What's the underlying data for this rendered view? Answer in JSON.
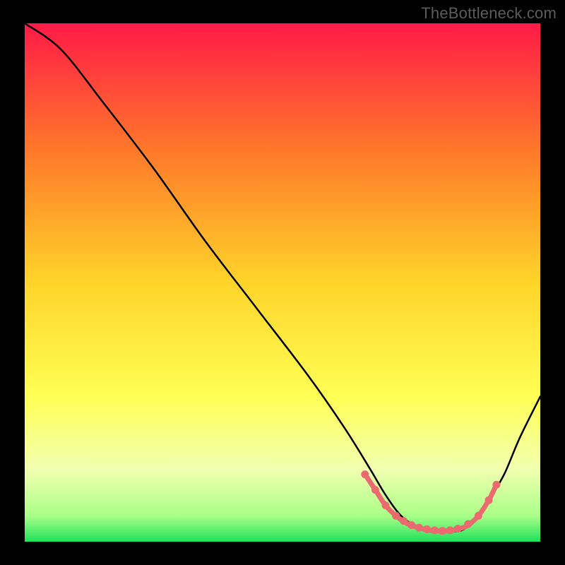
{
  "watermark": "TheBottleneck.com",
  "chart_data": {
    "type": "line",
    "title": "",
    "xlabel": "",
    "ylabel": "",
    "xlim": [
      0,
      100
    ],
    "ylim": [
      0,
      100
    ],
    "grid": false,
    "legend": false,
    "gradient_stops": [
      {
        "offset": 0.0,
        "color": "#ff1a47"
      },
      {
        "offset": 0.25,
        "color": "#ff7a2a"
      },
      {
        "offset": 0.5,
        "color": "#ffd42a"
      },
      {
        "offset": 0.72,
        "color": "#ffff55"
      },
      {
        "offset": 0.86,
        "color": "#f2ffb0"
      },
      {
        "offset": 0.95,
        "color": "#aaff88"
      },
      {
        "offset": 1.0,
        "color": "#1fe05a"
      }
    ],
    "series": [
      {
        "name": "bottleneck-curve",
        "color": "#000000",
        "x": [
          0,
          7,
          15,
          25,
          35,
          45,
          55,
          62,
          67,
          70,
          73,
          76,
          80,
          84,
          86,
          88,
          90,
          93,
          96,
          100
        ],
        "y": [
          100,
          95,
          85,
          72,
          58,
          45,
          32,
          22,
          14,
          9,
          5,
          3,
          2,
          2,
          3,
          5,
          8,
          13,
          20,
          28
        ]
      }
    ],
    "markers": {
      "name": "highlight-dots",
      "color": "#eb6a6f",
      "x": [
        66,
        68,
        70,
        72,
        73.5,
        75,
        76.5,
        78,
        79.5,
        81,
        82.5,
        84,
        86,
        88,
        90,
        91.5
      ],
      "y": [
        13,
        10,
        7,
        5,
        4,
        3.2,
        2.7,
        2.4,
        2.2,
        2.1,
        2.2,
        2.5,
        3.4,
        5,
        8,
        11
      ]
    },
    "highlight_path": {
      "name": "highlight-stroke",
      "color": "#eb6a6f",
      "x": [
        66,
        68,
        70,
        72,
        74,
        76,
        78,
        80,
        82,
        84,
        86,
        88,
        90,
        91.5
      ],
      "y": [
        13,
        10,
        7,
        5,
        3.6,
        2.8,
        2.3,
        2.1,
        2.1,
        2.4,
        3.2,
        5,
        8,
        11
      ]
    }
  }
}
